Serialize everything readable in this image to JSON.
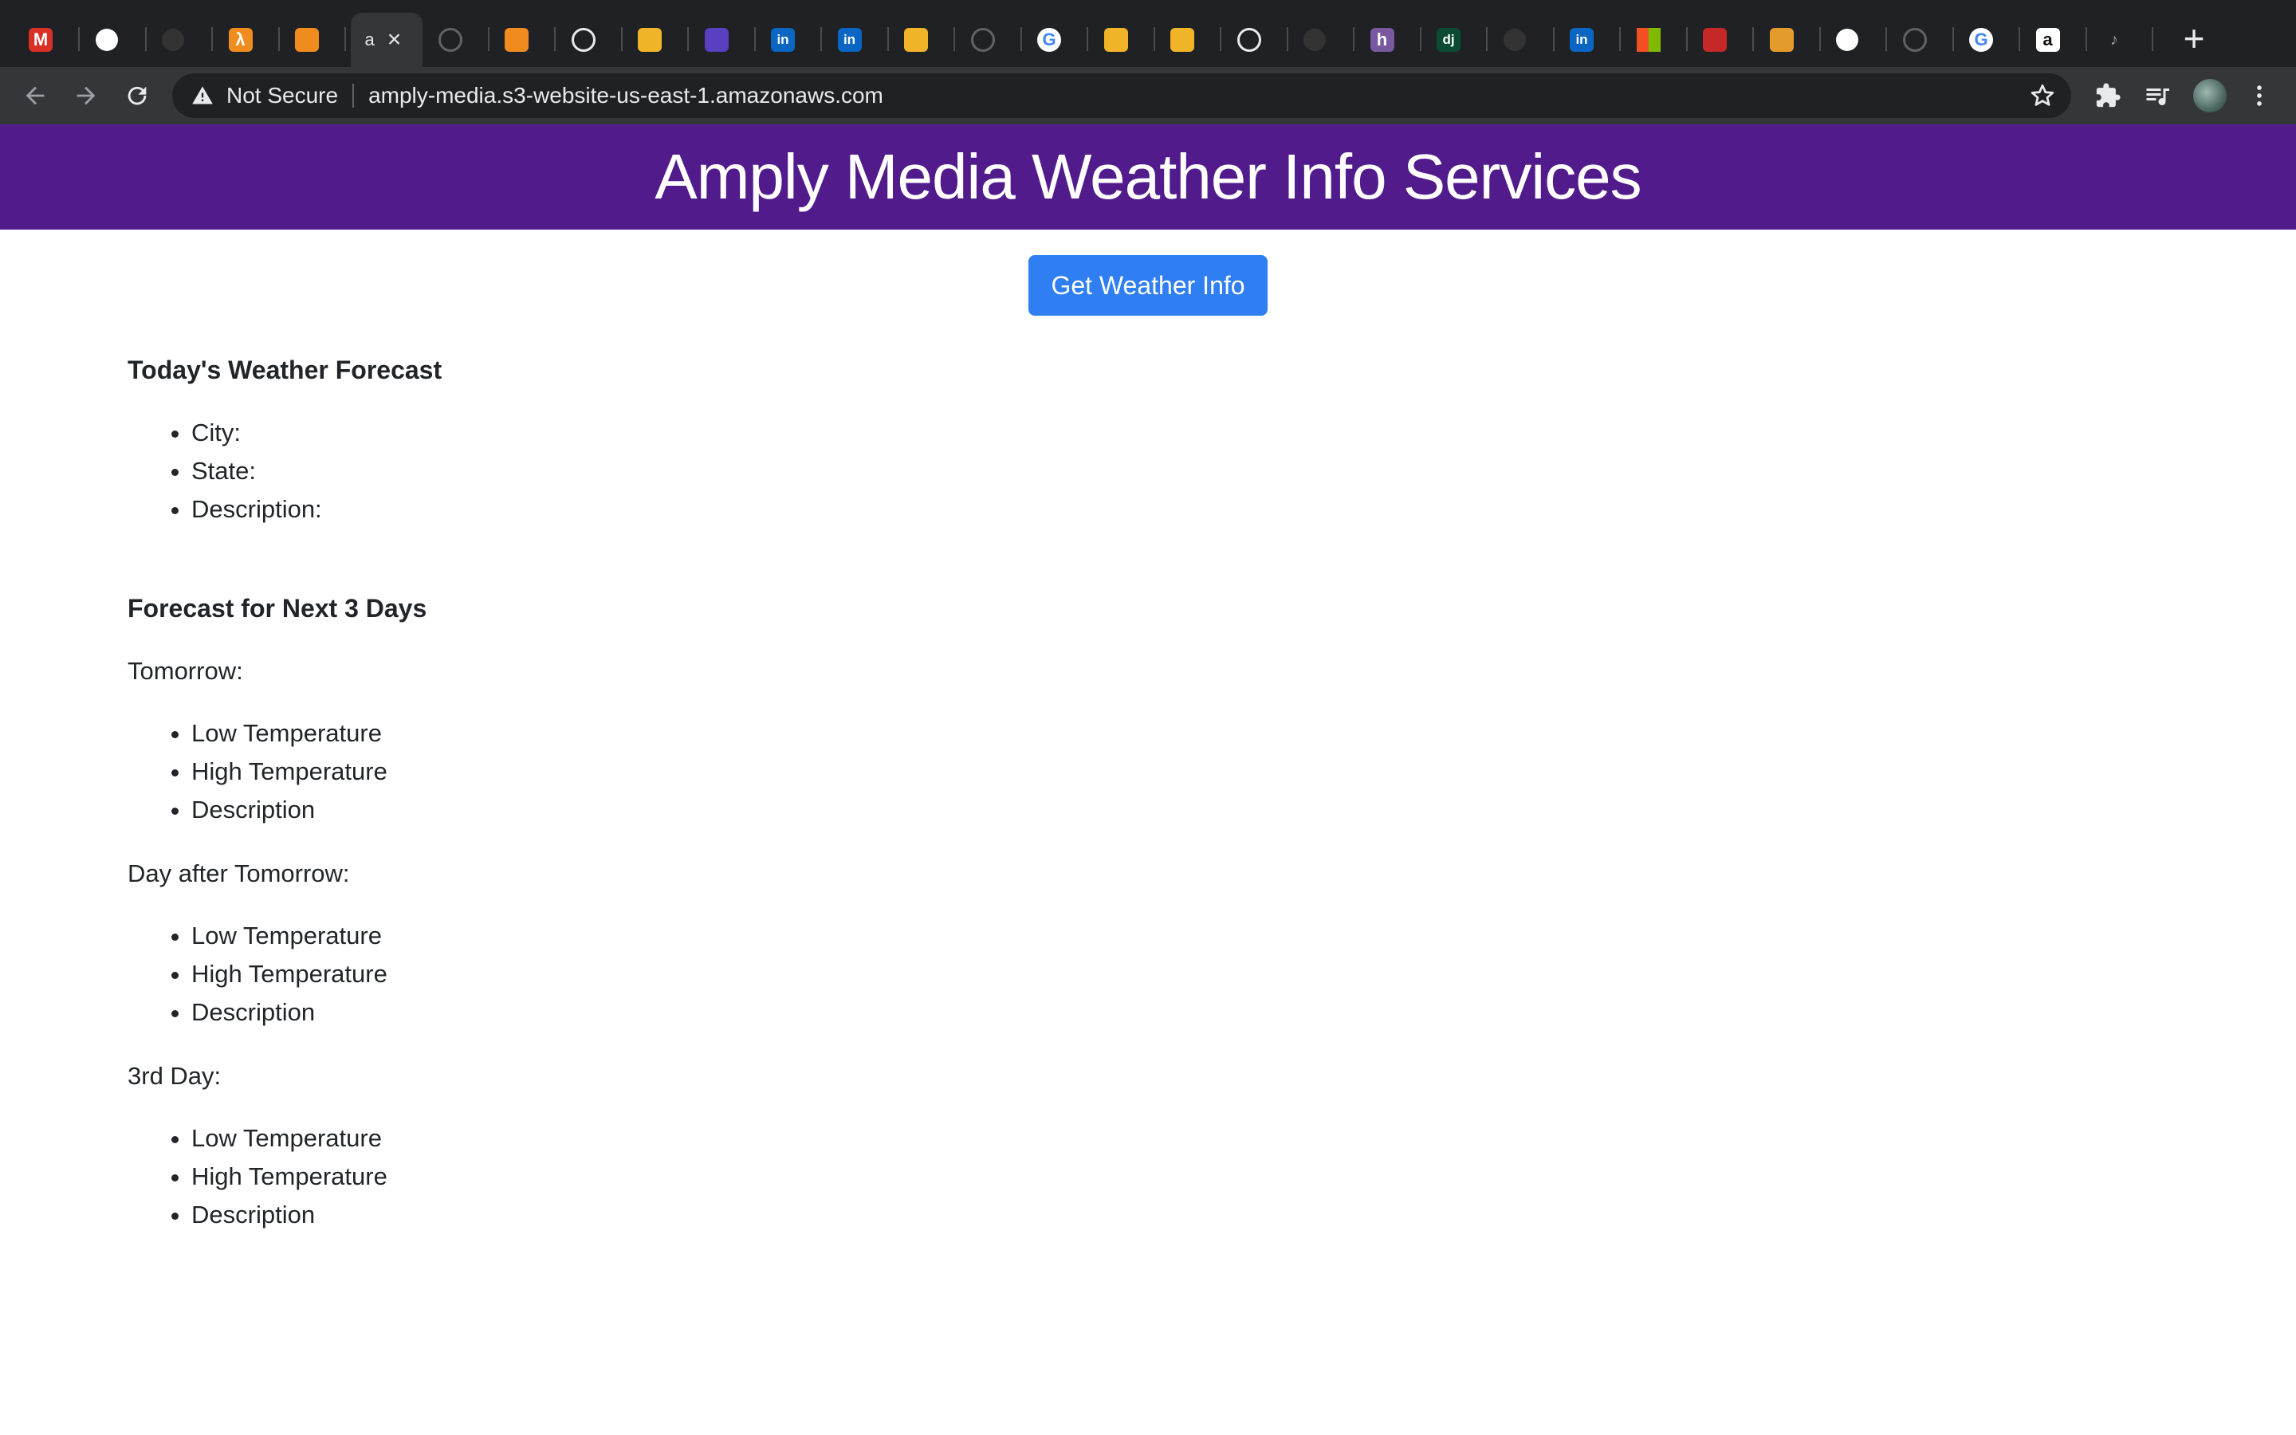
{
  "browser": {
    "active_tab": {
      "title": "a"
    },
    "tabs": [
      {
        "icon": "gmail-icon",
        "letter": "M",
        "color": "#d93025"
      },
      {
        "icon": "github-icon",
        "letter": "",
        "color": "#ffffff"
      },
      {
        "icon": "github-icon",
        "letter": "",
        "color": "#333333"
      },
      {
        "icon": "aws-lambda-icon",
        "letter": "λ",
        "color": "#f08c1e"
      },
      {
        "icon": "aws-box-icon",
        "letter": "",
        "color": "#f08c1e"
      },
      {
        "icon": "globe-icon",
        "letter": "",
        "color": "#5f6368"
      },
      {
        "icon": "aws-box-icon",
        "letter": "",
        "color": "#f08c1e"
      },
      {
        "icon": "globe-icon",
        "letter": "",
        "color": "#e8eaed"
      },
      {
        "icon": "cube-icon",
        "letter": "",
        "color": "#f0b428"
      },
      {
        "icon": "chart-icon",
        "letter": "",
        "color": "#5a3fc0"
      },
      {
        "icon": "linkedin-icon",
        "letter": "in",
        "color": "#0a66c2"
      },
      {
        "icon": "linkedin-icon",
        "letter": "in",
        "color": "#0a66c2"
      },
      {
        "icon": "cube-icon",
        "letter": "",
        "color": "#f0b428"
      },
      {
        "icon": "globe-icon",
        "letter": "",
        "color": "#5f6368"
      },
      {
        "icon": "google-icon",
        "letter": "G",
        "color": "#ffffff"
      },
      {
        "icon": "cube-icon",
        "letter": "",
        "color": "#f0b428"
      },
      {
        "icon": "cube-icon",
        "letter": "",
        "color": "#f0b428"
      },
      {
        "icon": "globe-icon",
        "letter": "",
        "color": "#e8eaed"
      },
      {
        "icon": "github-icon",
        "letter": "",
        "color": "#333333"
      },
      {
        "icon": "heroku-icon",
        "letter": "h",
        "color": "#79589f"
      },
      {
        "icon": "django-icon",
        "letter": "dj",
        "color": "#0c4b33"
      },
      {
        "icon": "github-icon",
        "letter": "",
        "color": "#333333"
      },
      {
        "icon": "linkedin-icon",
        "letter": "in",
        "color": "#0a66c2"
      },
      {
        "icon": "microsoft-icon",
        "letter": "",
        "color": "#f25022"
      },
      {
        "icon": "ball-icon",
        "letter": "",
        "color": "#c62828"
      },
      {
        "icon": "bird-icon",
        "letter": "",
        "color": "#e39b2b"
      },
      {
        "icon": "github-icon",
        "letter": "",
        "color": "#ffffff"
      },
      {
        "icon": "globe-icon",
        "letter": "",
        "color": "#5f6368"
      },
      {
        "icon": "google-icon",
        "letter": "G",
        "color": "#ffffff"
      },
      {
        "icon": "amazon-icon",
        "letter": "a",
        "color": "#ffffff"
      },
      {
        "icon": "audio-icon",
        "letter": "",
        "color": "#9aa0a6"
      }
    ],
    "omnibox": {
      "security_label": "Not Secure",
      "url": "amply-media.s3-website-us-east-1.amazonaws.com"
    }
  },
  "page": {
    "header_title": "Amply Media Weather Info Services",
    "button_label": "Get Weather Info",
    "today": {
      "heading": "Today's Weather Forecast",
      "items": [
        "City:",
        "State:",
        "Description:"
      ]
    },
    "forecast": {
      "heading": "Forecast for Next 3 Days",
      "days": [
        {
          "label": "Tomorrow:",
          "items": [
            "Low Temperature",
            "High Temperature",
            "Description"
          ]
        },
        {
          "label": "Day after Tomorrow:",
          "items": [
            "Low Temperature",
            "High Temperature",
            "Description"
          ]
        },
        {
          "label": "3rd Day:",
          "items": [
            "Low Temperature",
            "High Temperature",
            "Description"
          ]
        }
      ]
    }
  },
  "colors": {
    "header_bg": "#521b8c",
    "button_bg": "#2f7ff2"
  }
}
